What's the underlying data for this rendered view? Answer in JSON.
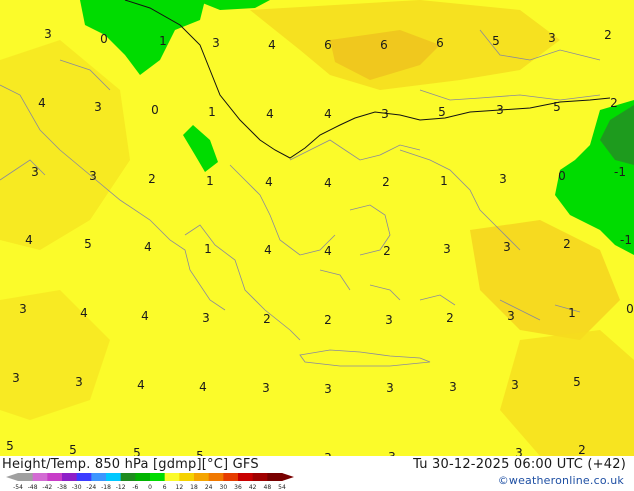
{
  "map": {
    "field_values": [
      "3",
      "0",
      "1",
      "3",
      "4",
      "6",
      "6",
      "6",
      "5",
      "3",
      "2",
      "4",
      "3",
      "0",
      "1",
      "4",
      "4",
      "3",
      "5",
      "3",
      "5",
      "2",
      "3",
      "3",
      "2",
      "1",
      "4",
      "4",
      "2",
      "1",
      "3",
      "0",
      "-1",
      "4",
      "5",
      "4",
      "1",
      "4",
      "4",
      "2",
      "3",
      "3",
      "2",
      "-1",
      "3",
      "4",
      "4",
      "3",
      "2",
      "2",
      "3",
      "2",
      "3",
      "1",
      "0",
      "3",
      "3",
      "4",
      "4",
      "3",
      "3",
      "3",
      "3",
      "3",
      "5",
      "5",
      "5",
      "5",
      "5",
      "3",
      "3",
      "3",
      "2"
    ]
  },
  "footer": {
    "title_left": "Height/Temp. 850 hPa [gdmp][°C] GFS",
    "title_right": "Tu 30-12-2025 06:00 UTC (+42)",
    "credit": "©weatheronline.co.uk"
  },
  "scale": {
    "ticks": [
      "-54",
      "-48",
      "-42",
      "-38",
      "-30",
      "-24",
      "-18",
      "-12",
      "-6",
      "0",
      "6",
      "12",
      "18",
      "24",
      "30",
      "36",
      "42",
      "48",
      "54"
    ],
    "colors": [
      "#a0a0a0",
      "#d36bd3",
      "#c83cc8",
      "#8d1fc8",
      "#3c3cff",
      "#3c96ff",
      "#00c8ff",
      "#1e8c1e",
      "#00b400",
      "#00dc00",
      "#fbfb2a",
      "#f5d200",
      "#f5a500",
      "#f07800",
      "#e63c00",
      "#c80000",
      "#a00000",
      "#780000"
    ]
  }
}
